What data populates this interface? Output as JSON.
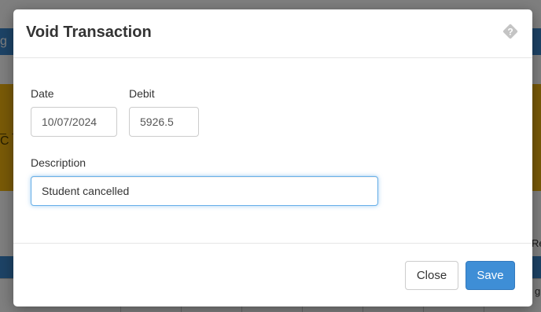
{
  "background": {
    "navbar_text": "g",
    "panel_line": "_ _",
    "panel_letter": "C",
    "side_text": "Re",
    "table_text": "g"
  },
  "modal": {
    "title": "Void Transaction",
    "help_icon": "question-diamond-icon",
    "fields": {
      "date": {
        "label": "Date",
        "value": "10/07/2024"
      },
      "debit": {
        "label": "Debit",
        "value": "5926.5"
      },
      "description": {
        "label": "Description",
        "value": "Student cancelled"
      }
    },
    "buttons": {
      "close_label": "Close",
      "save_label": "Save"
    }
  },
  "colors": {
    "primary": "#3e8ed6",
    "navbar": "#3a86cc",
    "panel": "#f2b50f",
    "focus": "#66afe9"
  }
}
